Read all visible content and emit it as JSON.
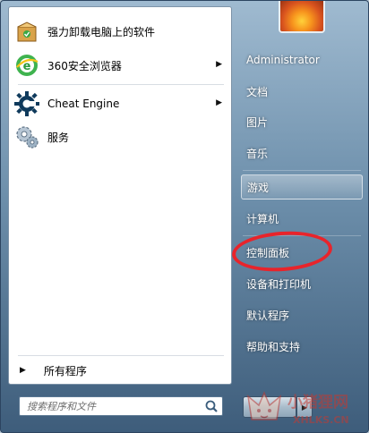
{
  "programs": [
    {
      "label": "强力卸载电脑上的软件",
      "icon": "uninstall-box-icon"
    },
    {
      "label": "360安全浏览器",
      "icon": "browser-360-icon"
    },
    {
      "label": "Cheat Engine",
      "icon": "gear-icon"
    },
    {
      "label": "服务",
      "icon": "services-gears-icon"
    }
  ],
  "all_programs_label": "所有程序",
  "search": {
    "placeholder": "搜索程序和文件"
  },
  "right_items": [
    {
      "label": "Administrator"
    },
    {
      "label": "文档"
    },
    {
      "label": "图片"
    },
    {
      "label": "音乐"
    },
    {
      "label": "游戏"
    },
    {
      "label": "计算机"
    },
    {
      "label": "控制面板"
    },
    {
      "label": "设备和打印机"
    },
    {
      "label": "默认程序"
    },
    {
      "label": "帮助和支持"
    }
  ],
  "watermark": {
    "text": "小猪狸网",
    "sub": "XHLKS.CN"
  },
  "colors": {
    "highlight_ellipse": "#e8242b",
    "watermark": "#c23a32"
  }
}
